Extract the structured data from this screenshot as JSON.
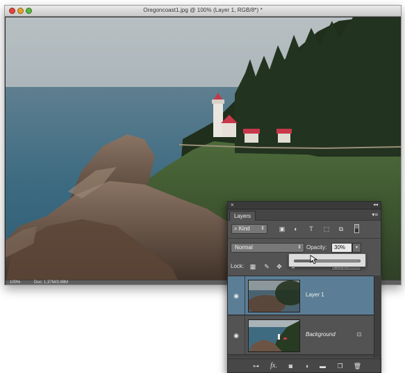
{
  "document": {
    "title": "Oregoncoast1.jpg @ 100% (Layer 1, RGB/8*) *",
    "status": {
      "zoom": "100%",
      "doc_info": "Doc: 1.37M/3.98M"
    }
  },
  "layers_panel": {
    "close_glyph": "×",
    "collapse_glyph": "◂◂",
    "tab_label": "Layers",
    "menu_glyph": "▾≡",
    "filter": {
      "kind_label": "Kind",
      "kind_arrow": "⇕",
      "icons": [
        "image-filter-icon",
        "adjustment-filter-icon",
        "type-filter-icon",
        "shape-filter-icon",
        "smart-object-filter-icon",
        "filter-toggle-icon"
      ]
    },
    "blend_mode": "Normal",
    "blend_arrow": "⇕",
    "opacity_label": "Opacity:",
    "opacity_value": "30%",
    "opacity_dropdown_glyph": "▾",
    "opacity_slider_fraction": 0.3,
    "lock_label": "Lock:",
    "lock_icons": [
      "lock-transparent-pixels-icon",
      "lock-image-pixels-icon",
      "lock-position-icon",
      "lock-all-icon"
    ],
    "fill_value": "100%",
    "layers": [
      {
        "name": "Layer 1",
        "visible": true,
        "selected": true,
        "locked": false
      },
      {
        "name": "Background",
        "visible": true,
        "selected": false,
        "locked": true
      }
    ],
    "footer_icons": [
      "link-layers-icon",
      "fx-icon",
      "add-mask-icon",
      "new-adjustment-layer-icon",
      "new-group-icon",
      "new-layer-icon",
      "delete-layer-icon"
    ],
    "footer_fx_label": "fx."
  },
  "colors": {
    "panel_bg": "#535353",
    "selected_layer": "#5b7e96",
    "lighthouse_roof": "#c8384a"
  }
}
